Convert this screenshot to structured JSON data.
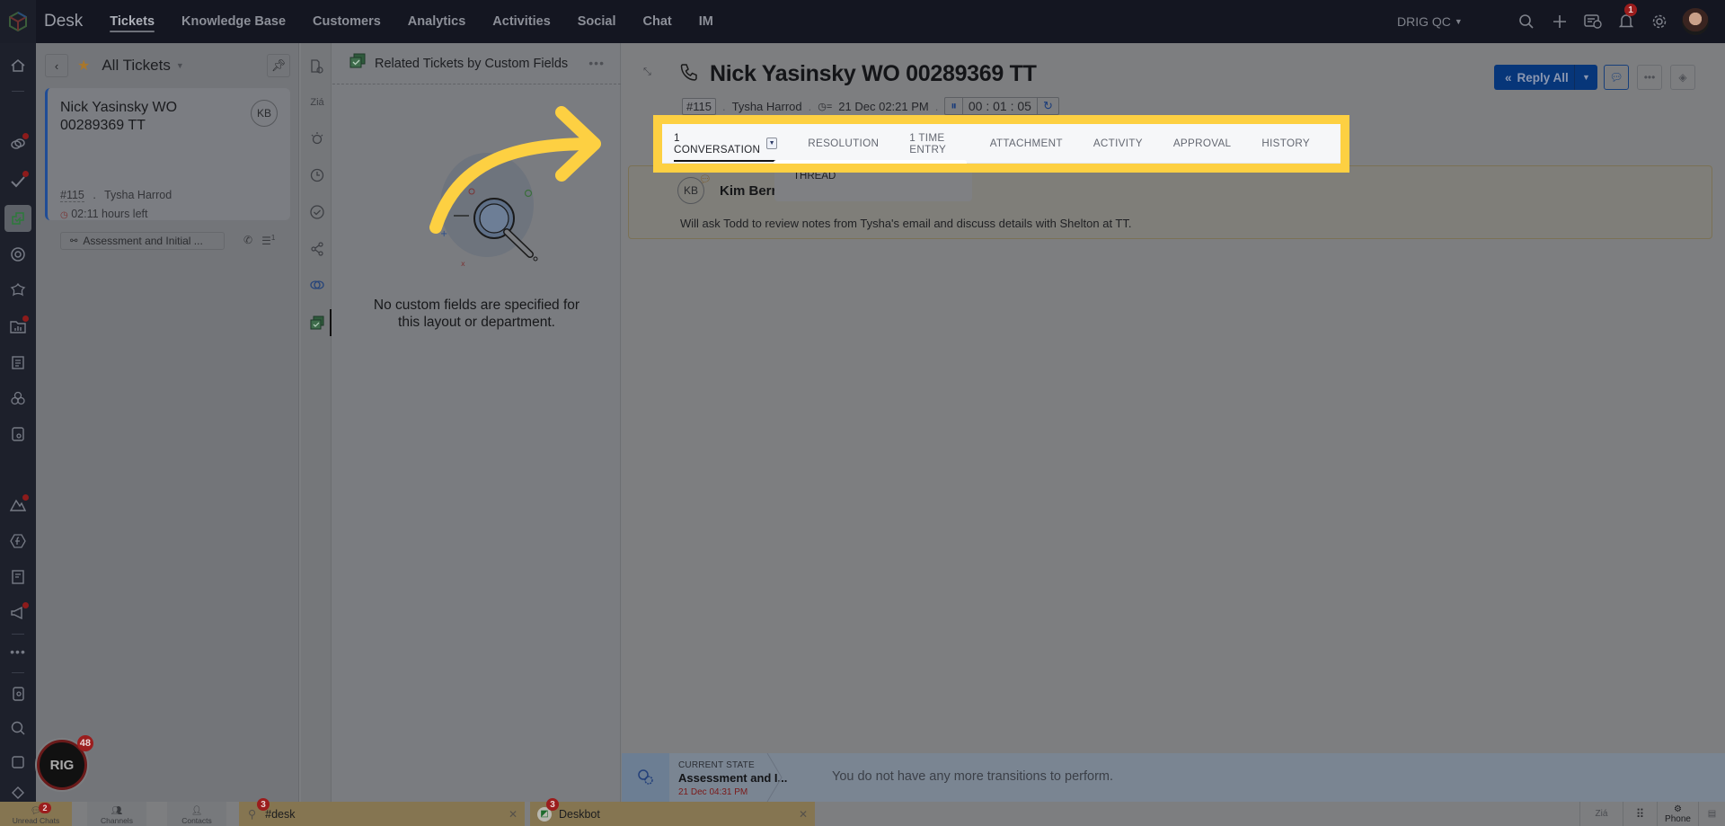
{
  "topbar": {
    "app_name": "Desk",
    "nav": [
      {
        "label": "Tickets",
        "active": true
      },
      {
        "label": "Knowledge Base"
      },
      {
        "label": "Customers"
      },
      {
        "label": "Analytics"
      },
      {
        "label": "Activities"
      },
      {
        "label": "Social"
      },
      {
        "label": "Chat"
      },
      {
        "label": "IM"
      }
    ],
    "org": "DRIG QC",
    "notification_count": "1",
    "icons": [
      "search-icon",
      "plus-icon",
      "ticket-alert-icon",
      "bell-icon",
      "gear-icon"
    ]
  },
  "left_sidebar": {
    "icons": [
      "home-icon",
      "link-icon",
      "check-icon",
      "tickets-icon",
      "mention-icon",
      "flower-icon",
      "folder-chart-icon",
      "notes-icon",
      "cubes-icon",
      "board-icon",
      "mountain-icon",
      "function-icon",
      "document-icon",
      "megaphone-icon",
      "more-icon",
      "contacts-book-icon",
      "search-user-icon",
      "wallet-icon",
      "tag-icon"
    ]
  },
  "ticket_list": {
    "view_title": "All Tickets",
    "tickets": [
      {
        "title": "Nick Yasinsky WO 00289369 TT",
        "avatar_initials": "KB",
        "number": "#115",
        "contact": "Tysha Harrod",
        "due": "02:11 hours left",
        "status": "Assessment and Initial ...",
        "thread_count": "1"
      }
    ]
  },
  "related_panel": {
    "title": "Related Tickets by Custom Fields",
    "empty_message_line1": "No custom fields are specified for",
    "empty_message_line2": "this layout or department."
  },
  "ticket": {
    "title": "Nick Yasinsky WO 00289369 TT",
    "number": "#115",
    "contact": "Tysha Harrod",
    "due_date": "21 Dec 02:21 PM",
    "timer": "00 : 01 : 05",
    "reply_label": "Reply All",
    "tabs": [
      {
        "label": "1 CONVERSATION",
        "active": true
      },
      {
        "label": "RESOLUTION"
      },
      {
        "label": "1 TIME ENTRY"
      },
      {
        "label": "ATTACHMENT"
      },
      {
        "label": "ACTIVITY"
      },
      {
        "label": "APPROVAL"
      },
      {
        "label": "HISTORY"
      }
    ],
    "conversation_filter_option": "THREAD",
    "conversation": {
      "author_initials": "KB",
      "author": "Kim Berr",
      "body": "Will ask Todd to review notes from Tysha's email and discuss details with Shelton at TT."
    }
  },
  "workflow": {
    "label": "CURRENT STATE",
    "state": "Assessment and I...",
    "date": "21 Dec 04:31 PM",
    "message": "You do not have any more transitions to perform."
  },
  "bottom_bar": {
    "unread_label": "Unread Chats",
    "unread_count": "2",
    "channels_label": "Channels",
    "contacts_label": "Contacts",
    "chat_tabs": [
      {
        "name": "#desk",
        "count": "3"
      },
      {
        "name": "Deskbot",
        "count": "3"
      }
    ],
    "phone_label": "Phone",
    "drig_badge": "48",
    "drig_logo_text": "RIG"
  },
  "colors": {
    "highlight": "#fdd042",
    "primary_button": "#073679",
    "badge": "#9b1d1d"
  }
}
